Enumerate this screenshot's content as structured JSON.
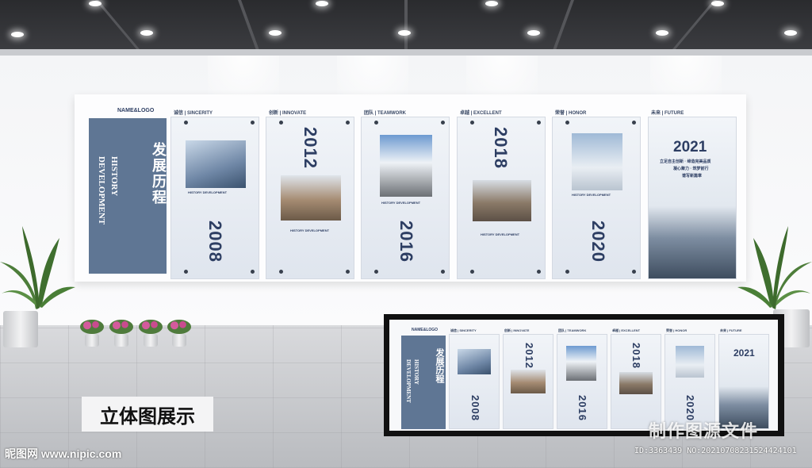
{
  "main_board": {
    "logo": "NAME&LOGO",
    "intro_cn": "发展历程",
    "intro_en_line1": "HISTORY",
    "intro_en_line2": "DEVELOPMENT",
    "panels": [
      {
        "title": "诚信 | SINCERITY",
        "year": "2008",
        "caption": "HISTORY DEVELOPMENT"
      },
      {
        "title": "创新 | INNOVATE",
        "year": "2012",
        "caption": "HISTORY DEVELOPMENT"
      },
      {
        "title": "团队 | TEAMWORK",
        "year": "2016",
        "caption": "HISTORY DEVELOPMENT"
      },
      {
        "title": "卓越 | EXCELLENT",
        "year": "2018",
        "caption": "HISTORY DEVELOPMENT"
      },
      {
        "title": "荣誉 | HONOR",
        "year": "2020",
        "caption": "HISTORY DEVELOPMENT"
      },
      {
        "title": "未来 | FUTURE",
        "year": "2021",
        "slogan1": "立足自主创新 · 缔造完美品质",
        "slogan2": "凝心聚力 · 筑梦前行",
        "slogan3": "谱写新篇章"
      }
    ]
  },
  "preview_board": {
    "logo": "NAME&LOGO",
    "intro_cn": "发展历程",
    "intro_en_line1": "HISTORY",
    "intro_en_line2": "DEVELOPMENT",
    "titles": [
      "诚信 | SINCERITY",
      "创新 | INNOVATE",
      "团队 | TEAMWORK",
      "卓越 | EXCELLENT",
      "荣誉 | HONOR",
      "未来 | FUTURE"
    ],
    "years": [
      "2008",
      "2012",
      "2016",
      "2018",
      "2020",
      "2021"
    ]
  },
  "label": "立体图展示",
  "watermark": "昵图网 www.nipic.com",
  "stamp": "制作图源文件",
  "id_text": "ID:3363439 NO:20210708231524424101",
  "colors": {
    "accent": "#5f7694",
    "navy": "#2d3e63",
    "ceiling": "#2f3034"
  }
}
